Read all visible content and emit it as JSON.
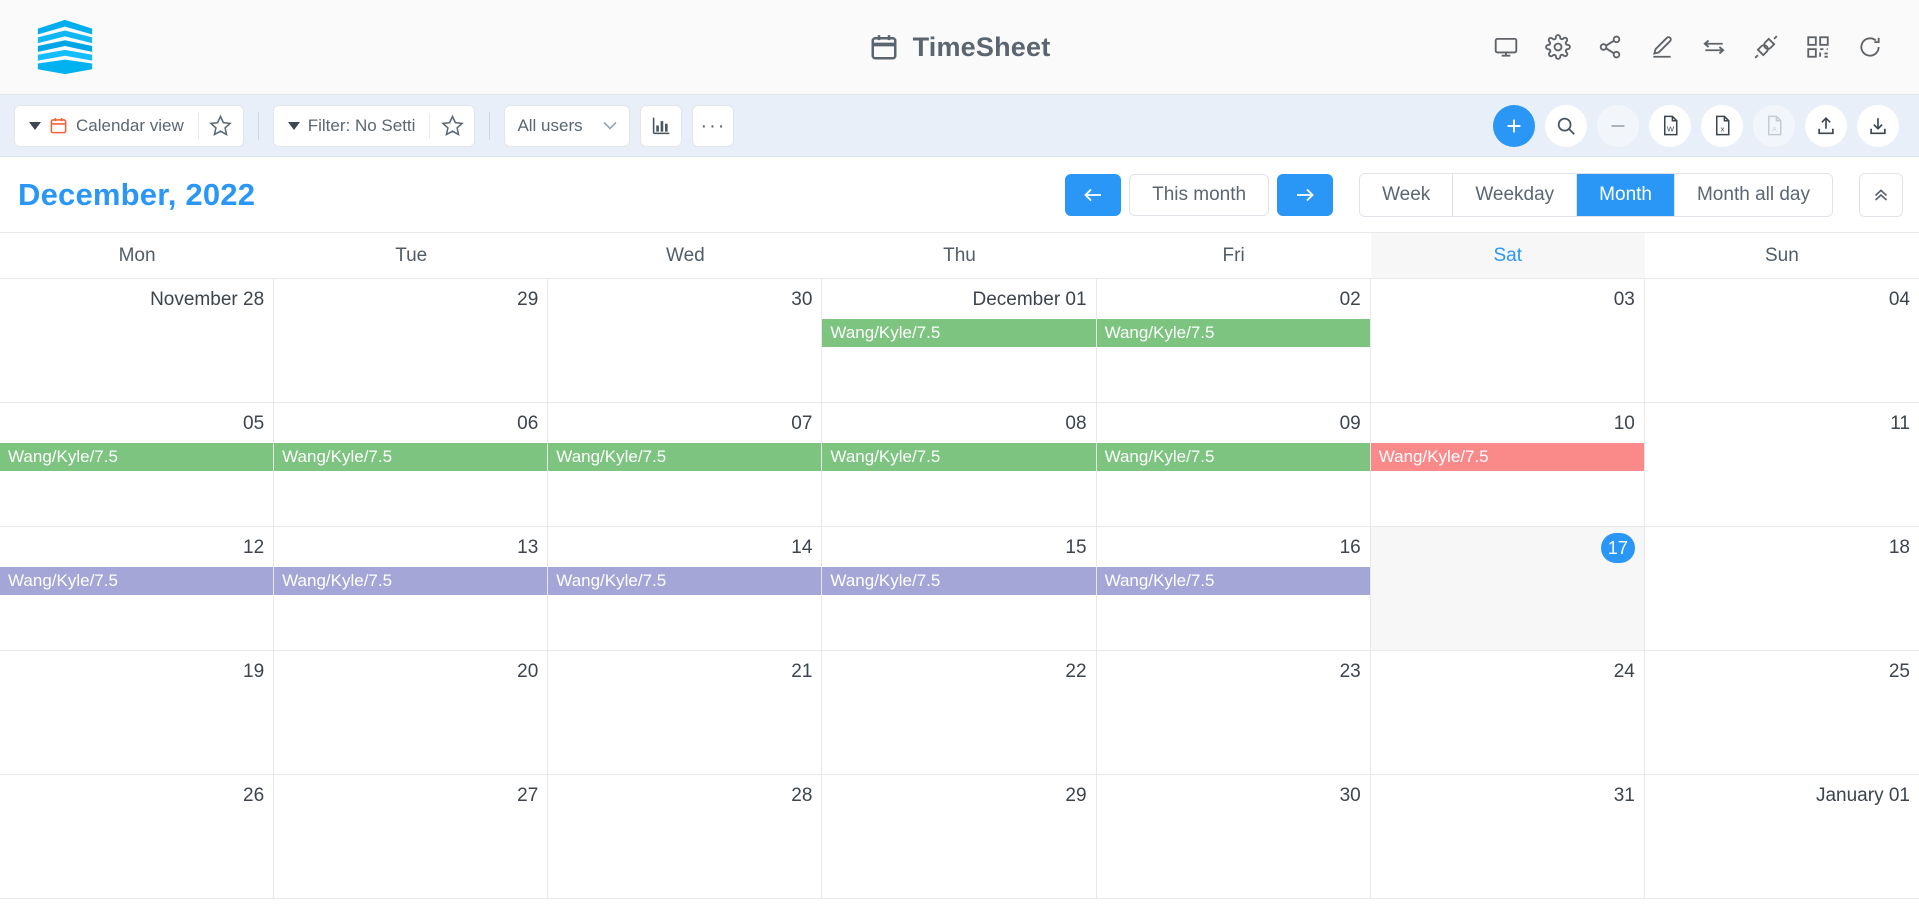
{
  "header": {
    "logo_name": "layers-logo",
    "title": "TimeSheet",
    "title_icon": "calendar-icon",
    "icons": [
      {
        "name": "monitor-icon",
        "label": "Display"
      },
      {
        "name": "gear-icon",
        "label": "Settings"
      },
      {
        "name": "share-icon",
        "label": "Share"
      },
      {
        "name": "edit-pencil-icon",
        "label": "Edit"
      },
      {
        "name": "swap-arrows-icon",
        "label": "Transfer"
      },
      {
        "name": "plugin-icon",
        "label": "Plugin"
      },
      {
        "name": "qr-code-icon",
        "label": "QR Code"
      },
      {
        "name": "refresh-icon",
        "label": "Refresh"
      }
    ]
  },
  "toolbar": {
    "view_label": "Calendar view",
    "view_icon": "calendar-red-icon",
    "view_star": "star-icon",
    "filter_label": "Filter: No Setti",
    "filter_star": "star-icon",
    "users_label": "All users",
    "chart_icon": "bar-chart-icon",
    "more_label": "···",
    "actions": [
      {
        "name": "add-button",
        "icon": "plus-icon",
        "style": "accent"
      },
      {
        "name": "search-button",
        "icon": "search-icon",
        "style": "plain"
      },
      {
        "name": "remove-button",
        "icon": "minus-icon",
        "style": "muted"
      },
      {
        "name": "export-word-button",
        "icon": "word-file-icon",
        "style": "plain"
      },
      {
        "name": "export-excel-button",
        "icon": "excel-file-icon",
        "style": "plain"
      },
      {
        "name": "export-pdf-button",
        "icon": "pdf-file-icon",
        "style": "muted"
      },
      {
        "name": "upload-button",
        "icon": "upload-icon",
        "style": "plain"
      },
      {
        "name": "download-button",
        "icon": "download-icon",
        "style": "plain"
      }
    ]
  },
  "datebar": {
    "month_title": "December, 2022",
    "prev_label": "←",
    "this_month_label": "This month",
    "next_label": "→",
    "views": [
      {
        "label": "Week",
        "active": false
      },
      {
        "label": "Weekday",
        "active": false
      },
      {
        "label": "Month",
        "active": true
      },
      {
        "label": "Month all day",
        "active": false
      }
    ],
    "collapse_icon": "chevron-double-up-icon"
  },
  "calendar": {
    "day_names": [
      {
        "label": "Mon",
        "today": false
      },
      {
        "label": "Tue",
        "today": false
      },
      {
        "label": "Wed",
        "today": false
      },
      {
        "label": "Thu",
        "today": false
      },
      {
        "label": "Fri",
        "today": false
      },
      {
        "label": "Sat",
        "today": true
      },
      {
        "label": "Sun",
        "today": false
      }
    ],
    "event_colors": {
      "green": "#7cc47f",
      "red": "#fa8a8a",
      "purple": "#a3a6d7"
    },
    "weeks": [
      {
        "days": [
          {
            "num": "November 28",
            "today": false,
            "events": []
          },
          {
            "num": "29",
            "today": false,
            "events": []
          },
          {
            "num": "30",
            "today": false,
            "events": []
          },
          {
            "num": "December 01",
            "today": false,
            "events": [
              {
                "label": "Wang/Kyle/7.5",
                "color": "green"
              }
            ]
          },
          {
            "num": "02",
            "today": false,
            "events": [
              {
                "label": "Wang/Kyle/7.5",
                "color": "green"
              }
            ]
          },
          {
            "num": "03",
            "today": false,
            "events": []
          },
          {
            "num": "04",
            "today": false,
            "events": []
          }
        ]
      },
      {
        "days": [
          {
            "num": "05",
            "today": false,
            "events": [
              {
                "label": "Wang/Kyle/7.5",
                "color": "green"
              }
            ]
          },
          {
            "num": "06",
            "today": false,
            "events": [
              {
                "label": "Wang/Kyle/7.5",
                "color": "green"
              }
            ]
          },
          {
            "num": "07",
            "today": false,
            "events": [
              {
                "label": "Wang/Kyle/7.5",
                "color": "green"
              }
            ]
          },
          {
            "num": "08",
            "today": false,
            "events": [
              {
                "label": "Wang/Kyle/7.5",
                "color": "green"
              }
            ]
          },
          {
            "num": "09",
            "today": false,
            "events": [
              {
                "label": "Wang/Kyle/7.5",
                "color": "green"
              }
            ]
          },
          {
            "num": "10",
            "today": false,
            "events": [
              {
                "label": "Wang/Kyle/7.5",
                "color": "red"
              }
            ]
          },
          {
            "num": "11",
            "today": false,
            "events": []
          }
        ]
      },
      {
        "days": [
          {
            "num": "12",
            "today": false,
            "events": [
              {
                "label": "Wang/Kyle/7.5",
                "color": "purple"
              }
            ]
          },
          {
            "num": "13",
            "today": false,
            "events": [
              {
                "label": "Wang/Kyle/7.5",
                "color": "purple"
              }
            ]
          },
          {
            "num": "14",
            "today": false,
            "events": [
              {
                "label": "Wang/Kyle/7.5",
                "color": "purple"
              }
            ]
          },
          {
            "num": "15",
            "today": false,
            "events": [
              {
                "label": "Wang/Kyle/7.5",
                "color": "purple"
              }
            ]
          },
          {
            "num": "16",
            "today": false,
            "events": [
              {
                "label": "Wang/Kyle/7.5",
                "color": "purple"
              }
            ]
          },
          {
            "num": "17",
            "today": true,
            "events": []
          },
          {
            "num": "18",
            "today": false,
            "events": []
          }
        ]
      },
      {
        "days": [
          {
            "num": "19",
            "today": false,
            "events": []
          },
          {
            "num": "20",
            "today": false,
            "events": []
          },
          {
            "num": "21",
            "today": false,
            "events": []
          },
          {
            "num": "22",
            "today": false,
            "events": []
          },
          {
            "num": "23",
            "today": false,
            "events": []
          },
          {
            "num": "24",
            "today": false,
            "events": []
          },
          {
            "num": "25",
            "today": false,
            "events": []
          }
        ]
      },
      {
        "days": [
          {
            "num": "26",
            "today": false,
            "events": []
          },
          {
            "num": "27",
            "today": false,
            "events": []
          },
          {
            "num": "28",
            "today": false,
            "events": []
          },
          {
            "num": "29",
            "today": false,
            "events": []
          },
          {
            "num": "30",
            "today": false,
            "events": []
          },
          {
            "num": "31",
            "today": false,
            "events": []
          },
          {
            "num": "January 01",
            "today": false,
            "events": []
          }
        ]
      }
    ]
  }
}
